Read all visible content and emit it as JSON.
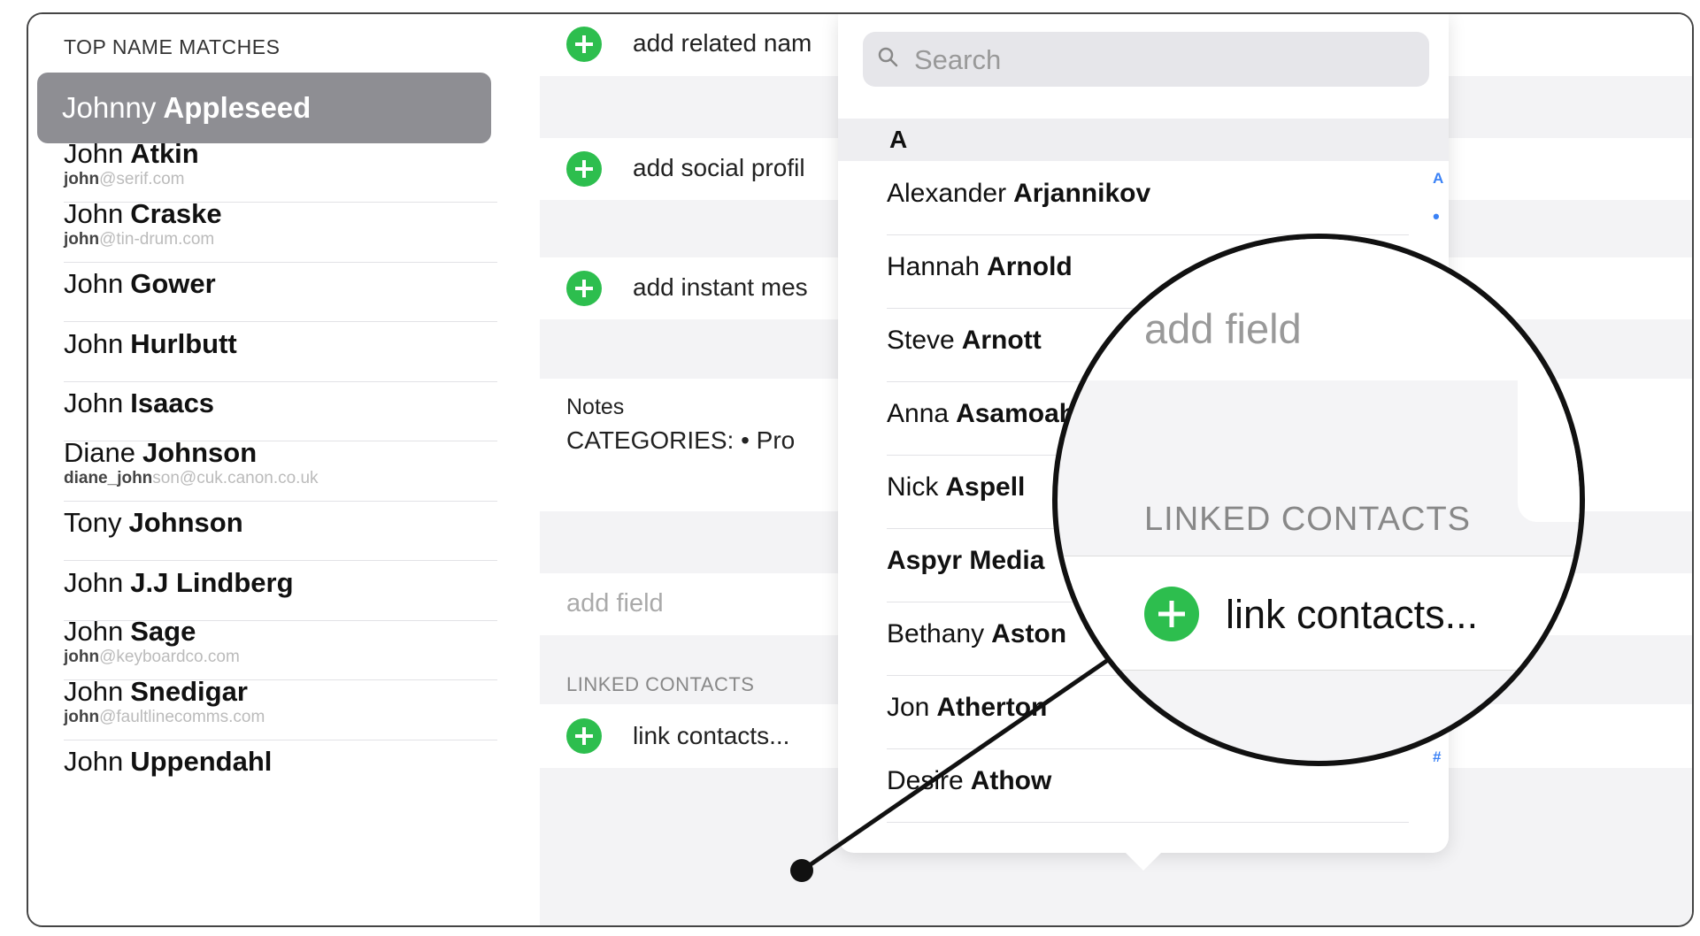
{
  "left": {
    "header": "TOP NAME MATCHES",
    "selected": {
      "first": "Johnny",
      "last": "Appleseed"
    },
    "contacts": [
      {
        "first": "John",
        "last": "Atkin",
        "email_pre": "john",
        "email_rest": "@serif.com"
      },
      {
        "first": "John",
        "last": "Craske",
        "email_pre": "john",
        "email_rest": "@tin-drum.com"
      },
      {
        "first": "John",
        "last": "Gower",
        "email_pre": "",
        "email_rest": ""
      },
      {
        "first": "John",
        "last": "Hurlbutt",
        "email_pre": "",
        "email_rest": ""
      },
      {
        "first": "John",
        "last": "Isaacs",
        "email_pre": "",
        "email_rest": ""
      },
      {
        "first": "Diane",
        "last": "Johnson",
        "email_pre": "diane_john",
        "email_rest": "son@cuk.canon.co.uk"
      },
      {
        "first": "Tony",
        "last": "Johnson",
        "email_pre": "",
        "email_rest": ""
      },
      {
        "first": "John",
        "last": "J.J Lindberg",
        "email_pre": "",
        "email_rest": ""
      },
      {
        "first": "John",
        "last": "Sage",
        "email_pre": "john",
        "email_rest": "@keyboardco.com"
      },
      {
        "first": "John",
        "last": "Snedigar",
        "email_pre": "john",
        "email_rest": "@faultlinecomms.com"
      },
      {
        "first": "John",
        "last": "Uppendahl",
        "email_pre": "",
        "email_rest": ""
      }
    ]
  },
  "middle": {
    "add_related": "add related nam",
    "add_social": "add social profil",
    "add_instant": "add instant mes",
    "notes_label": "Notes",
    "notes_value": "CATEGORIES: • Pro",
    "add_field": "add field",
    "linked_contacts": "LINKED CONTACTS",
    "link_contacts": "link contacts..."
  },
  "popup": {
    "search_placeholder": "Search",
    "section": "A",
    "index_top": "A",
    "index_dot": "•",
    "index_hash": "#",
    "people": [
      {
        "first": "Alexander",
        "last": "Arjannikov"
      },
      {
        "first": "Hannah",
        "last": "Arnold"
      },
      {
        "first": "Steve",
        "last": "Arnott"
      },
      {
        "first": "Anna",
        "last": "Asamoah"
      },
      {
        "first": "Nick",
        "last": "Aspell"
      },
      {
        "first": "",
        "last": "Aspyr Media"
      },
      {
        "first": "Bethany",
        "last": "Aston"
      },
      {
        "first": "Jon",
        "last": "Atherton"
      },
      {
        "first": "Desire",
        "last": "Athow"
      }
    ]
  },
  "magnifier": {
    "add_field": "add field",
    "linked_contacts": "LINKED CONTACTS",
    "link_contacts": "link contacts..."
  },
  "colors": {
    "accent_green": "#2dbe4e",
    "selected_gray": "#8e8e93",
    "index_blue": "#3b82f6"
  }
}
